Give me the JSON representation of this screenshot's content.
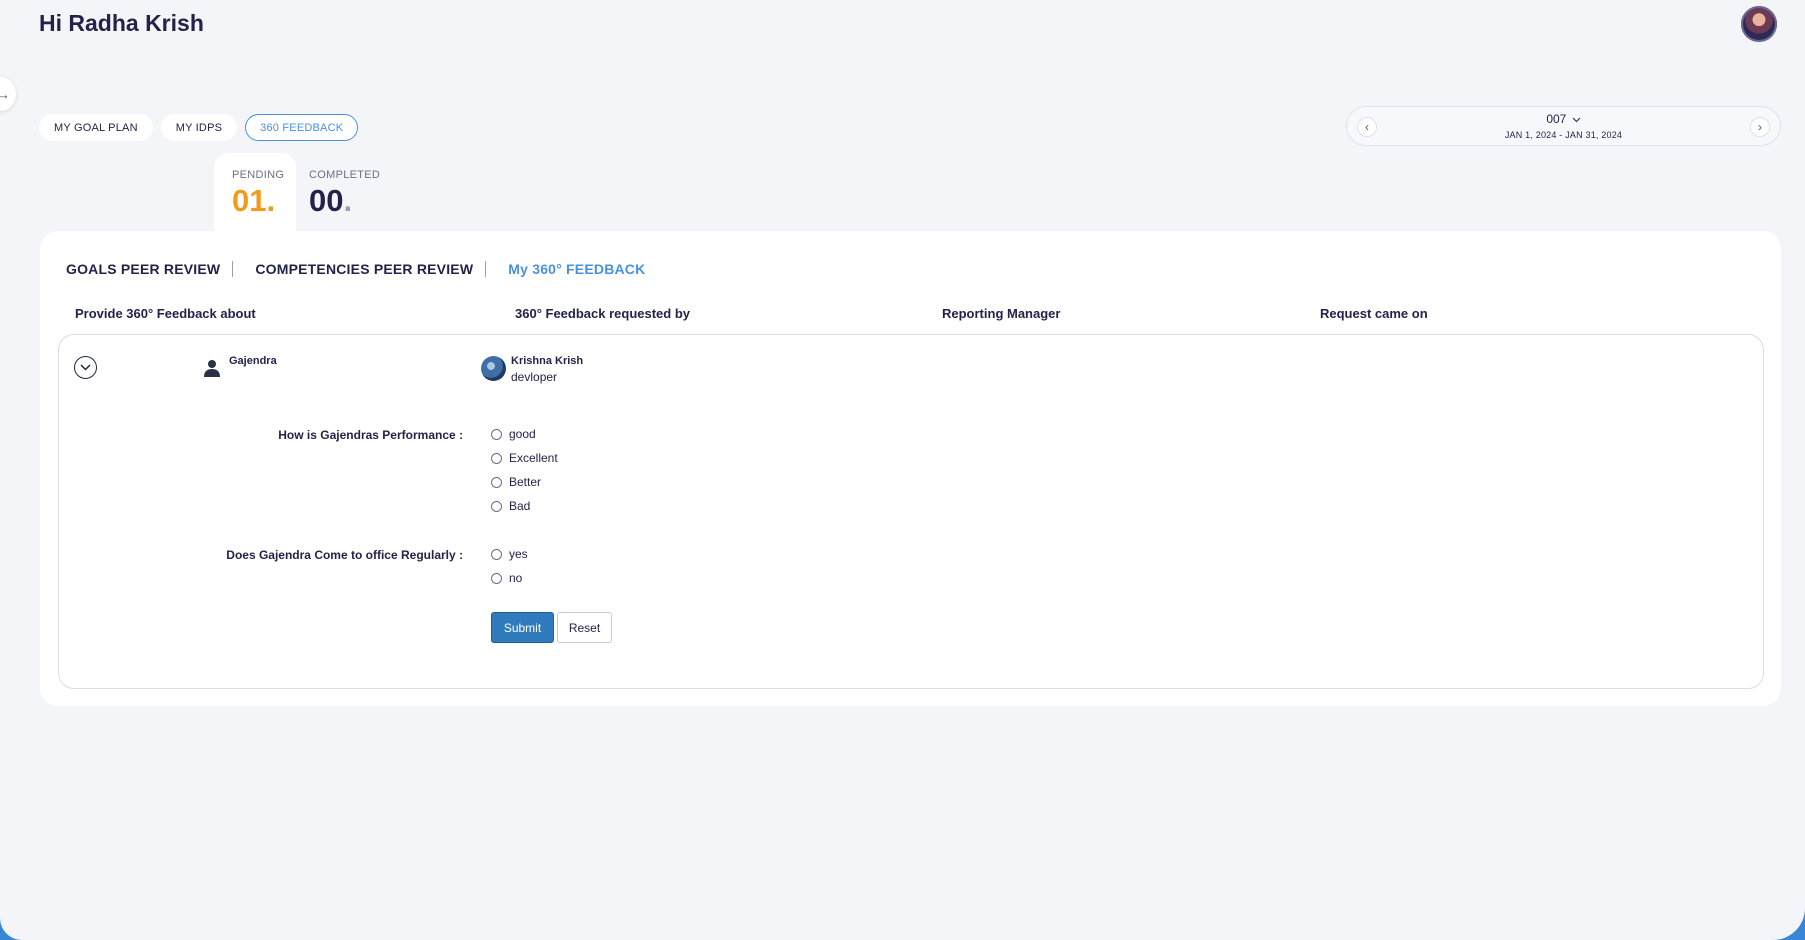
{
  "header": {
    "greeting": "Hi Radha Krish",
    "sidebar_toggle_icon": "arrow-right-icon",
    "avatar_icon": "user-avatar"
  },
  "pills": [
    {
      "label": "MY GOAL PLAN",
      "active": false
    },
    {
      "label": "MY IDPS",
      "active": false
    },
    {
      "label": "360 FEEDBACK",
      "active": true
    }
  ],
  "period": {
    "code": "007",
    "range": "JAN 1, 2024 - JAN 31, 2024",
    "prev_icon": "chevron-left-icon",
    "next_icon": "chevron-right-icon",
    "dropdown_icon": "chevron-down-icon"
  },
  "stats": {
    "pending": {
      "label": "PENDING",
      "value": "01"
    },
    "completed": {
      "label": "COMPLETED",
      "value": "00"
    }
  },
  "subtabs": [
    {
      "label": "GOALS PEER REVIEW",
      "active": false
    },
    {
      "label": "COMPETENCIES PEER REVIEW",
      "active": false
    },
    {
      "label": "My 360° FEEDBACK",
      "active": true
    }
  ],
  "table": {
    "columns": [
      "Provide 360° Feedback about",
      "360° Feedback requested by",
      "Reporting Manager",
      "Request came on"
    ],
    "row": {
      "subject": "Gajendra",
      "requester_name": "Krishna Krish",
      "requester_role": "devloper",
      "reporting_manager": "",
      "request_date": ""
    }
  },
  "form": {
    "questions": [
      {
        "label": "How is Gajendras Performance :",
        "options": [
          "good",
          "Excellent",
          "Better",
          "Bad"
        ]
      },
      {
        "label": "Does Gajendra Come to office Regularly :",
        "options": [
          "yes",
          "no"
        ]
      }
    ],
    "submit_label": "Submit",
    "reset_label": "Reset"
  },
  "colors": {
    "accent": "#4a90e2",
    "pending": "#f39a1d",
    "text": "#23234a",
    "submit": "#2f7bbd"
  }
}
